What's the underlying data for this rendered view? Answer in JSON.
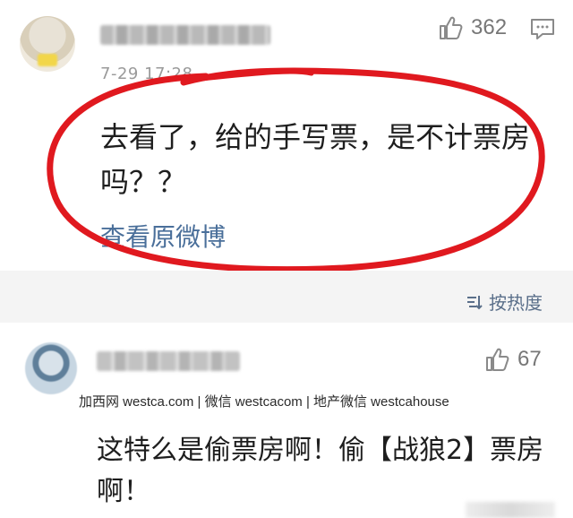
{
  "comment1": {
    "date": "7-29 17:28",
    "text": "去看了，给的手写票，是不计票房吗？？",
    "view_original": "查看原微博",
    "likes": "362"
  },
  "sort": {
    "label": "按热度"
  },
  "comment2": {
    "likes": "67",
    "text": "这特么是偷票房啊！偷【战狼2】票房啊！"
  },
  "watermark": {
    "text": "加西网 westca.com | 微信 westcacom | 地产微信 westcahouse"
  },
  "colors": {
    "accent_link": "#4a6f9a",
    "annotation_red": "#e0191f",
    "separator_bg": "#f4f4f4"
  },
  "icons": [
    "thumbs-up-icon",
    "reply-icon",
    "sort-icon"
  ]
}
